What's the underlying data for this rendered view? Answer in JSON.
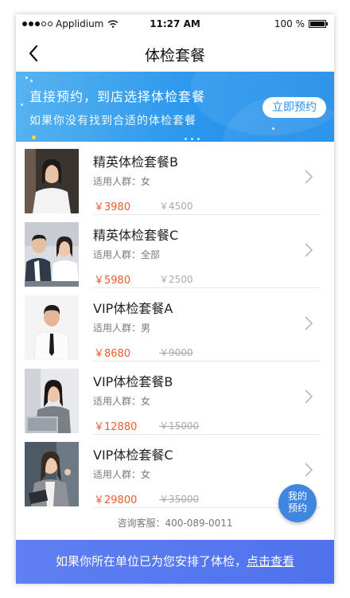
{
  "status_bar": {
    "carrier": "Applidium",
    "time": "11:27 AM",
    "battery": "100 %"
  },
  "nav": {
    "title": "体检套餐"
  },
  "banner": {
    "line1": "直接预约，到店选择体检套餐",
    "line2": "如果你没有找到合适的体检套餐",
    "button": "立即预约"
  },
  "packages": [
    {
      "name": "精英体检套餐B",
      "group_label": "适用人群：",
      "group": "女",
      "price": "￥3980",
      "original_price": "￥4500",
      "strikethrough": false
    },
    {
      "name": "精英体检套餐C",
      "group_label": "适用人群：",
      "group": "全部",
      "price": "￥5980",
      "original_price": "￥2500",
      "strikethrough": false
    },
    {
      "name": "VIP体检套餐A",
      "group_label": "适用人群：",
      "group": "男",
      "price": "￥8680",
      "original_price": "￥9000",
      "strikethrough": true
    },
    {
      "name": "VIP体检套餐B",
      "group_label": "适用人群：",
      "group": "女",
      "price": "￥12880",
      "original_price": "￥15000",
      "strikethrough": true
    },
    {
      "name": "VIP体检套餐C",
      "group_label": "适用人群：",
      "group": "女",
      "price": "￥29800",
      "original_price": "￥35000",
      "strikethrough": true
    }
  ],
  "service": "咨询客服：400-089-0011",
  "float_button": {
    "line1": "我的",
    "line2": "预约"
  },
  "bottom_bar": {
    "text": "如果你所在单位已为您安排了体检，",
    "link": "点击查看"
  },
  "colors": {
    "accent": "#2c97ee",
    "price": "#f25a2c",
    "bottom_bar": "#5f7ff2"
  }
}
